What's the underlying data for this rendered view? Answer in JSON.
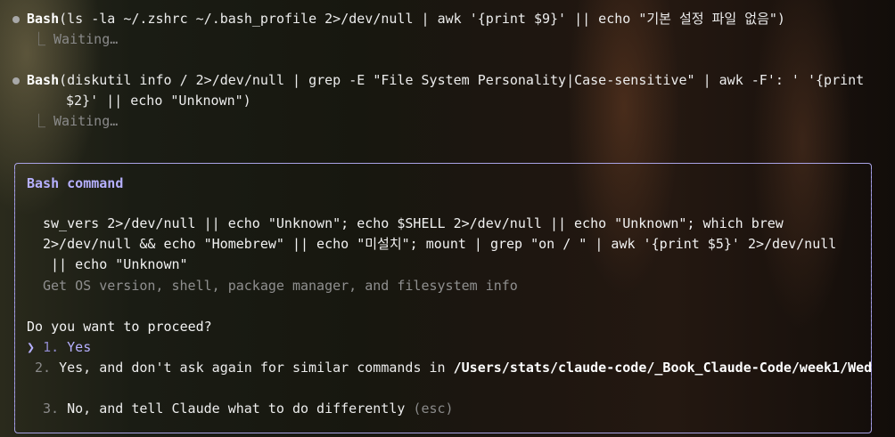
{
  "history": [
    {
      "tool": "Bash",
      "line1": "(ls -la ~/.zshrc ~/.bash_profile 2>/dev/null | awk '{print $9}' || echo \"기본 설정 파일 없음\")",
      "line2": "",
      "status": "Waiting…"
    },
    {
      "tool": "Bash",
      "line1": "(diskutil info / 2>/dev/null | grep -E \"File System Personality|Case-sensitive\" | awk -F': ' '{print",
      "line2": "$2}' || echo \"Unknown\")",
      "status": "Waiting…"
    }
  ],
  "dialog": {
    "title": "Bash command",
    "code_lines": [
      "sw_vers 2>/dev/null || echo \"Unknown\"; echo $SHELL 2>/dev/null || echo \"Unknown\"; which brew",
      "2>/dev/null && echo \"Homebrew\" || echo \"미설치\"; mount | grep \"on / \" | awk '{print $5}' 2>/dev/null",
      " || echo \"Unknown\""
    ],
    "description": "Get OS version, shell, package manager, and filesystem info",
    "question": "Do you want to proceed?",
    "cursor": "❯",
    "options": [
      {
        "num": "1.",
        "label": "Yes"
      },
      {
        "num": "2.",
        "label": "Yes, and don't ask again for similar commands in ",
        "path": "/Users/stats/claude-code/_Book_Claude-Code/week1/Wed"
      },
      {
        "num": "3.",
        "label": "No, and tell Claude what to do differently",
        "hint": "(esc)"
      }
    ]
  },
  "icons": {
    "bullet": "bullet-dot-icon",
    "corner": "tree-corner-icon",
    "cursor": "chevron-right-icon"
  }
}
